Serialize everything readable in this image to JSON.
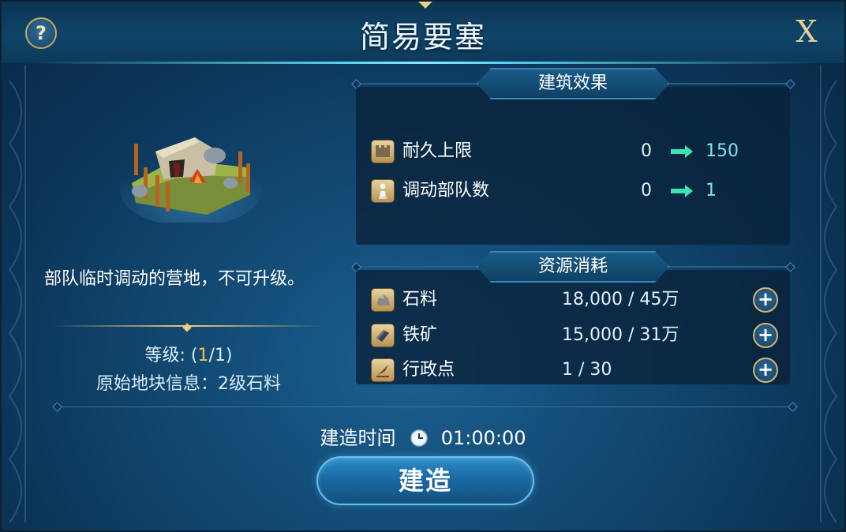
{
  "header": {
    "title": "简易要塞",
    "help_label": "?",
    "close_label": "X"
  },
  "left": {
    "description": "部队临时调动的营地，不可升级。",
    "level_prefix": "等级: (",
    "level_value": "1",
    "level_suffix": "/1)",
    "origin_info": "原始地块信息：2级石料"
  },
  "effects": {
    "title": "建筑效果",
    "items": [
      {
        "icon": "wall-icon",
        "label": "耐久上限",
        "from": "0",
        "to": "150"
      },
      {
        "icon": "pawn-icon",
        "label": "调动部队数",
        "from": "0",
        "to": "1"
      }
    ]
  },
  "resources": {
    "title": "资源消耗",
    "items": [
      {
        "icon": "stone-icon",
        "label": "石料",
        "amount": "18,000 / 45万"
      },
      {
        "icon": "iron-icon",
        "label": "铁矿",
        "amount": "15,000 / 31万"
      },
      {
        "icon": "quill-icon",
        "label": "行政点",
        "amount": "1 / 30"
      }
    ],
    "add_label": "+"
  },
  "build": {
    "time_label": "建造时间",
    "time_value": "01:00:00",
    "button_label": "建造"
  },
  "colors": {
    "arrow": "#3fe0b0",
    "target_value": "#7fe2f0",
    "gold": "#f2c24a"
  }
}
